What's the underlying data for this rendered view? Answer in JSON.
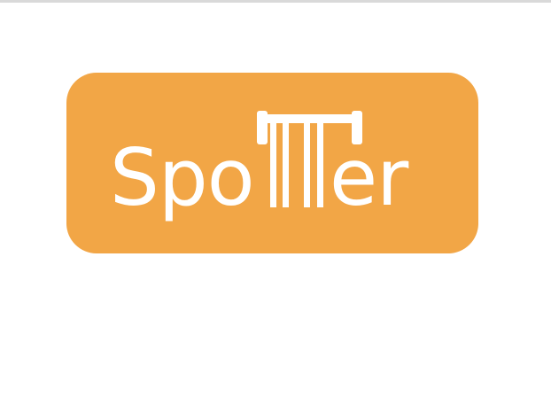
{
  "logo": {
    "brand_name": "Spotter",
    "wordmark_prefix": "Spo",
    "wordmark_suffix": "er",
    "accent_color": "#f2a646",
    "icon": "barbell-icon"
  }
}
